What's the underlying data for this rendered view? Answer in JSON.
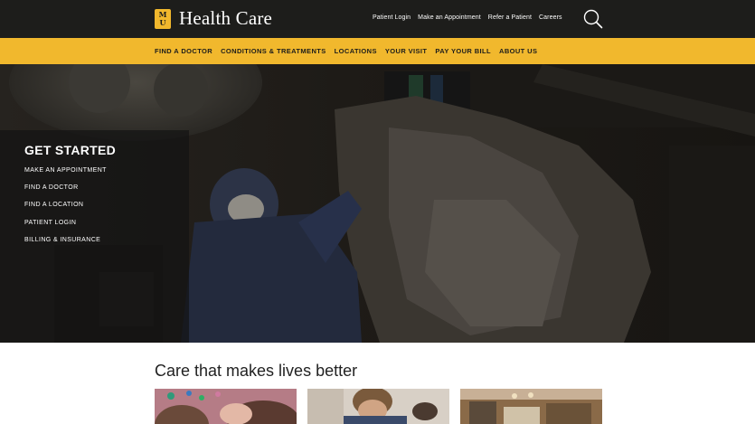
{
  "header": {
    "brand_name": "Health Care",
    "logo_top": "M",
    "logo_bottom": "U",
    "utility_links": [
      "Patient Login",
      "Make an Appointment",
      "Refer a Patient",
      "Careers"
    ]
  },
  "main_nav": {
    "items": [
      "FIND A DOCTOR",
      "CONDITIONS & TREATMENTS",
      "LOCATIONS",
      "YOUR VISIT",
      "PAY YOUR BILL",
      "ABOUT US"
    ]
  },
  "get_started": {
    "title": "GET STARTED",
    "links": [
      "MAKE AN APPOINTMENT",
      "FIND A DOCTOR",
      "FIND A LOCATION",
      "PATIENT LOGIN",
      "BILLING & INSURANCE"
    ]
  },
  "content": {
    "heading": "Care that makes lives better"
  },
  "icons": {
    "search": "search-icon",
    "logo": "mu-logo-icon"
  },
  "colors": {
    "header_bg": "#1d1d1b",
    "accent_gold": "#f1b82d",
    "hero_overlay": "#141414"
  }
}
